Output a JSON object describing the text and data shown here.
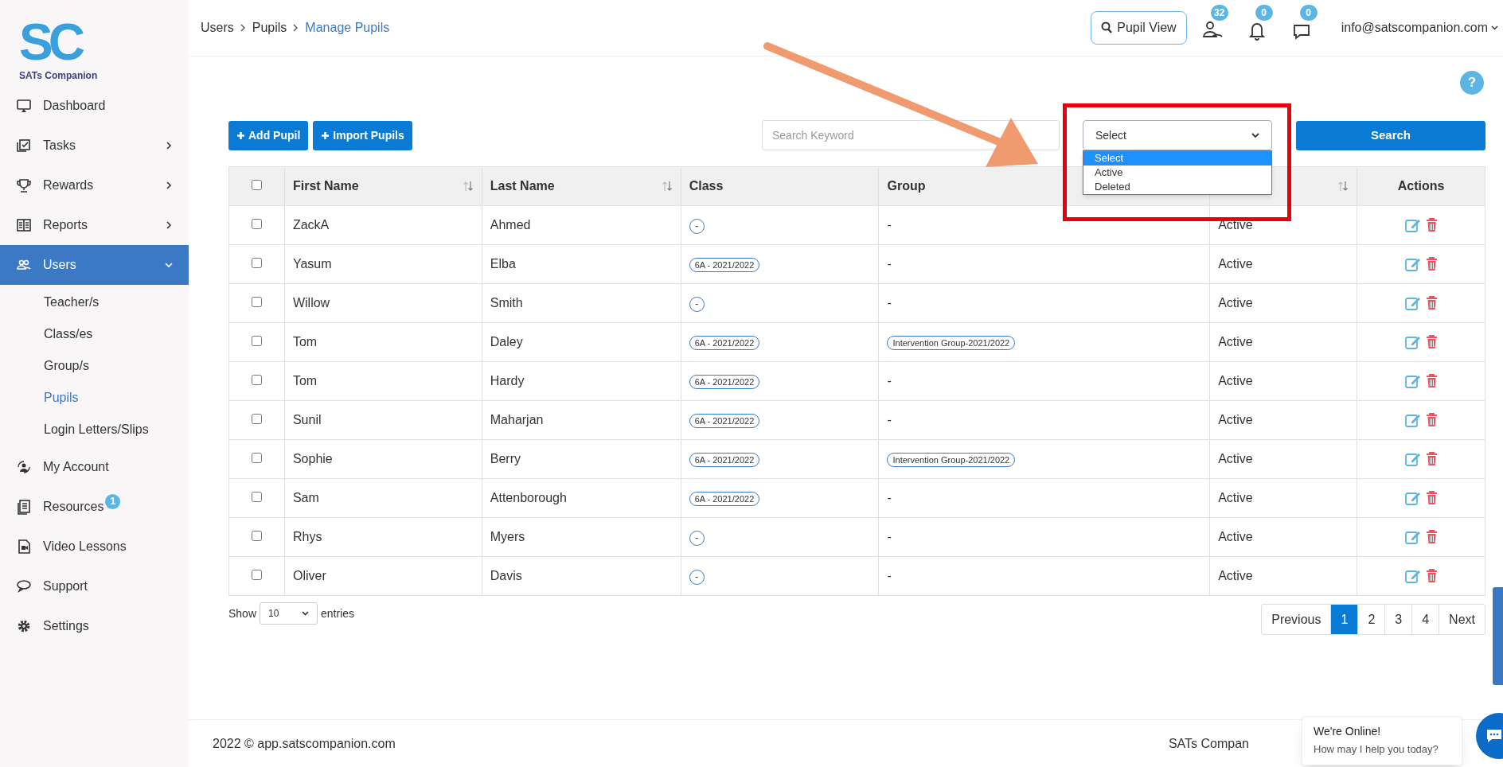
{
  "logo": {
    "mark": "SC",
    "name": "SATs Companion"
  },
  "sidebar": {
    "items": [
      {
        "label": "Dashboard",
        "selected": false
      },
      {
        "label": "Tasks",
        "selected": false,
        "expanded": false
      },
      {
        "label": "Rewards",
        "selected": false,
        "expanded": false
      },
      {
        "label": "Reports",
        "selected": false,
        "expanded": false
      },
      {
        "label": "Users",
        "selected": true,
        "expanded": true,
        "children": [
          {
            "label": "Teacher/s",
            "selected": false
          },
          {
            "label": "Class/es",
            "selected": false
          },
          {
            "label": "Group/s",
            "selected": false
          },
          {
            "label": "Pupils",
            "selected": true
          },
          {
            "label": "Login Letters/Slips",
            "selected": false
          }
        ]
      },
      {
        "label": "My Account",
        "selected": false
      },
      {
        "label": "Resources",
        "selected": false,
        "badge": "1"
      },
      {
        "label": "Video Lessons",
        "selected": false
      },
      {
        "label": "Support",
        "selected": false
      },
      {
        "label": "Settings",
        "selected": false
      }
    ]
  },
  "breadcrumb": [
    {
      "label": "Users",
      "current": false
    },
    {
      "label": "Pupils",
      "current": false
    },
    {
      "label": "Manage Pupils",
      "current": true
    }
  ],
  "header": {
    "pupil_view": "Pupil View",
    "badges": [
      {
        "kind": "users",
        "count": "32"
      },
      {
        "kind": "bell",
        "count": "0"
      },
      {
        "kind": "chat",
        "count": "0"
      }
    ],
    "account": "info@satscompanion.com"
  },
  "help": "?",
  "toolbar": {
    "buttons": [
      "Add Pupil",
      "Import Pupils"
    ],
    "search": {
      "placeholder": "Search Keyword"
    },
    "status_select": {
      "value": "Select",
      "open": true,
      "options": [
        {
          "label": "Select",
          "selected": true
        },
        {
          "label": "Active",
          "selected": false
        },
        {
          "label": "Deleted",
          "selected": false
        }
      ]
    },
    "search_button": "Search"
  },
  "table": {
    "select_all_checked": false,
    "columns": [
      {
        "label": "First Name",
        "sortable": true
      },
      {
        "label": "Last Name",
        "sortable": true
      },
      {
        "label": "Class",
        "sortable": false
      },
      {
        "label": "Group"
      },
      {
        "sortable": true
      },
      {
        "label": "Actions",
        "sortable": false
      }
    ],
    "rows": [
      {
        "checked": false,
        "first": "ZackA",
        "last": "Ahmed",
        "class": "-",
        "group": "-",
        "status": "Active"
      },
      {
        "checked": false,
        "first": "Yasum",
        "last": "Elba",
        "class": "6A - 2021/2022",
        "group": "-",
        "status": "Active"
      },
      {
        "checked": false,
        "first": "Willow",
        "last": "Smith",
        "class": "-",
        "group": "-",
        "status": "Active"
      },
      {
        "checked": false,
        "first": "Tom",
        "last": "Daley",
        "class": "6A - 2021/2022",
        "group": "Intervention Group-2021/2022",
        "status": "Active"
      },
      {
        "checked": false,
        "first": "Tom",
        "last": "Hardy",
        "class": "6A - 2021/2022",
        "group": "-",
        "status": "Active"
      },
      {
        "checked": false,
        "first": "Sunil",
        "last": "Maharjan",
        "class": "6A - 2021/2022",
        "group": "-",
        "status": "Active"
      },
      {
        "checked": false,
        "first": "Sophie",
        "last": "Berry",
        "class": "6A - 2021/2022",
        "group": "Intervention Group-2021/2022",
        "status": "Active"
      },
      {
        "checked": false,
        "first": "Sam",
        "last": "Attenborough",
        "class": "6A - 2021/2022",
        "group": "-",
        "status": "Active"
      },
      {
        "checked": false,
        "first": "Rhys",
        "last": "Myers",
        "class": "-",
        "group": "-",
        "status": "Active"
      },
      {
        "checked": false,
        "first": "Oliver",
        "last": "Davis",
        "class": "-",
        "group": "-",
        "status": "Active"
      }
    ]
  },
  "length": {
    "before": "Show",
    "value": "10",
    "after": "entries"
  },
  "pagination": [
    {
      "label": "Previous",
      "selected": false
    },
    {
      "label": "1",
      "selected": true
    },
    {
      "label": "2",
      "selected": false
    },
    {
      "label": "3",
      "selected": false
    },
    {
      "label": "4",
      "selected": false
    },
    {
      "label": "Next",
      "selected": false
    }
  ],
  "footer": {
    "copyright": "2022 © app.satscompanion.com",
    "right": "SATs Compan"
  },
  "chat_popup": {
    "title": "We're Online!",
    "subtitle": "How may I help you today?"
  }
}
